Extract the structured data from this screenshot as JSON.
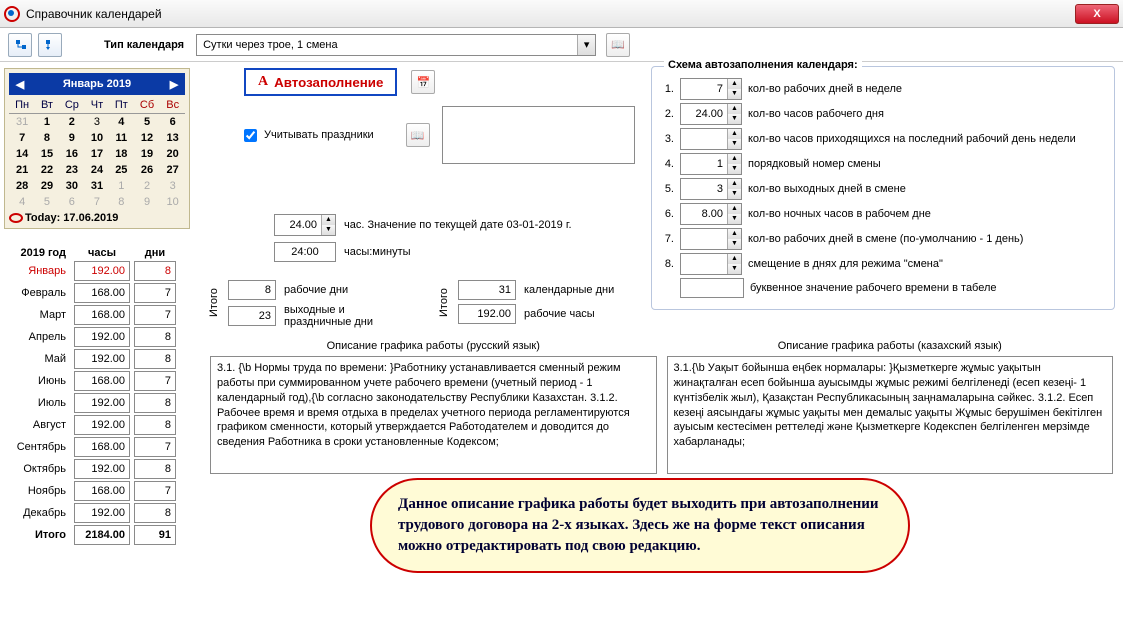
{
  "window": {
    "title": "Справочник календарей",
    "close": "X"
  },
  "toolbar": {
    "type_label": "Тип календаря",
    "type_value": "Сутки через трое, 1 смена"
  },
  "calendar": {
    "month_title": "Январь 2019",
    "weekdays": [
      "Пн",
      "Вт",
      "Ср",
      "Чт",
      "Пт",
      "Сб",
      "Вс"
    ],
    "prev_days": [
      31
    ],
    "days": [
      1,
      2,
      3,
      4,
      5,
      6,
      7,
      8,
      9,
      10,
      11,
      12,
      13,
      14,
      15,
      16,
      17,
      18,
      19,
      20,
      21,
      22,
      23,
      24,
      25,
      26,
      27,
      28,
      29,
      30,
      31
    ],
    "next_days": [
      1,
      2,
      3,
      4,
      5,
      6,
      7,
      8,
      9,
      10
    ],
    "selected_day": 3,
    "today_label": "Today: 17.06.2019"
  },
  "year_summary": {
    "year_label": "2019 год",
    "hours_label": "часы",
    "days_label": "дни",
    "months": [
      {
        "name": "Январь",
        "hours": "192.00",
        "days": "8"
      },
      {
        "name": "Февраль",
        "hours": "168.00",
        "days": "7"
      },
      {
        "name": "Март",
        "hours": "168.00",
        "days": "7"
      },
      {
        "name": "Апрель",
        "hours": "192.00",
        "days": "8"
      },
      {
        "name": "Май",
        "hours": "192.00",
        "days": "8"
      },
      {
        "name": "Июнь",
        "hours": "168.00",
        "days": "7"
      },
      {
        "name": "Июль",
        "hours": "192.00",
        "days": "8"
      },
      {
        "name": "Август",
        "hours": "192.00",
        "days": "8"
      },
      {
        "name": "Сентябрь",
        "hours": "168.00",
        "days": "7"
      },
      {
        "name": "Октябрь",
        "hours": "192.00",
        "days": "8"
      },
      {
        "name": "Ноябрь",
        "hours": "168.00",
        "days": "7"
      },
      {
        "name": "Декабрь",
        "hours": "192.00",
        "days": "8"
      }
    ],
    "total_label": "Итого",
    "total_hours": "2184.00",
    "total_days": "91"
  },
  "mid": {
    "autofill": "Автозаполнение",
    "holidays_check": "Учитывать праздники",
    "hours_value": "24.00",
    "hours_suffix": "час. Значение по текущей дате 03-01-2019 г.",
    "hm_value": "24:00",
    "hm_label": "часы:минуты",
    "itogo": "Итого",
    "work_days_val": "8",
    "work_days_lbl": "рабочие дни",
    "off_days_val": "23",
    "off_days_lbl": "выходные и праздничные дни",
    "cal_days_val": "31",
    "cal_days_lbl": "календарные дни",
    "work_hours_val": "192.00",
    "work_hours_lbl": "рабочие часы",
    "desc_ru_head": "Описание графика работы (русский язык)",
    "desc_ru_text": "3.1. {\\b Нормы труда по времени:  }Работнику устанавливается сменный режим работы при суммированном учете рабочего времени (учетный период - 1 календарный год),{\\b  согласно законодательству Республики Казахстан.\n3.1.2.  Рабочее время и время отдыха в пределах учетного периода регламентируются графиком сменности, который утверждается Работодателем и доводится до сведения Работника в сроки установленные Кодексом;",
    "desc_kz_head": "Описание графика работы (казахский язык)",
    "desc_kz_text": "3.1.{\\b  Уақыт бойынша еңбек нормалары:  }Қызметкерге жұмыс уақытын жинақталған есеп бойынша ауысымды жұмыс режимі белгіленеді (есеп кезеңі- 1 күнтізбелік жыл), Қазақстан Республикасының заңнамаларына сәйкес.\n3.1.2. Есеп кезеңі аясындағы жұмыс уақыты мен демалыс уақыты Жұмыс берушімен бекітілген ауысым кестесімен реттеледі және Қызметкерге Кодекспен белгіленген мерзімде хабарланады;"
  },
  "schema": {
    "legend": "Схема автозаполнения календаря:",
    "rows": [
      {
        "n": "1.",
        "val": "7",
        "lbl": "кол-во рабочих дней в неделе"
      },
      {
        "n": "2.",
        "val": "24.00",
        "lbl": "кол-во часов рабочего дня"
      },
      {
        "n": "3.",
        "val": "",
        "lbl": "кол-во часов приходящихся на последний рабочий день недели"
      },
      {
        "n": "4.",
        "val": "1",
        "lbl": "порядковый номер смены"
      },
      {
        "n": "5.",
        "val": "3",
        "lbl": "кол-во выходных дней в смене"
      },
      {
        "n": "6.",
        "val": "8.00",
        "lbl": "кол-во ночных часов в рабочем дне"
      },
      {
        "n": "7.",
        "val": "",
        "lbl": "кол-во рабочих дней в смене (по-умолчанию - 1 день)"
      },
      {
        "n": "8.",
        "val": "",
        "lbl": "смещение в днях для режима \"смена\""
      }
    ],
    "letter_lbl": "буквенное значение рабочего времени в табеле"
  },
  "callout": "Данное описание графика работы будет выходить при автозаполнении трудового договора на 2-х языках. Здесь же на форме текст описания можно отредактировать под свою редакцию."
}
